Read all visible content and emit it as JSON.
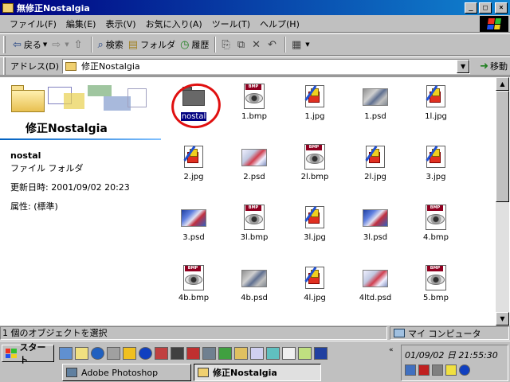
{
  "window": {
    "title": "無修正Nostalgia",
    "minimize": "_",
    "maximize": "□",
    "close": "×"
  },
  "menu": [
    "ファイル(F)",
    "編集(E)",
    "表示(V)",
    "お気に入り(A)",
    "ツール(T)",
    "ヘルプ(H)"
  ],
  "toolbar": {
    "back": "戻る",
    "search": "検索",
    "folders": "フォルダ",
    "history": "履歴"
  },
  "address": {
    "label": "アドレス(D)",
    "value": "修正Nostalgia",
    "go": "移動"
  },
  "leftpane": {
    "title": "修正Nostalgia",
    "selected_name": "nostal",
    "selected_type": "ファイル フォルダ",
    "selected_date": "更新日時: 2001/09/02 20:23",
    "selected_attr": "属性: (標準)"
  },
  "files": [
    {
      "name": "nostal",
      "type": "folder",
      "selected": true
    },
    {
      "name": "1.bmp",
      "type": "bmp"
    },
    {
      "name": "1.jpg",
      "type": "jpg"
    },
    {
      "name": "1.psd",
      "type": "psd",
      "variant": "grey"
    },
    {
      "name": "1l.jpg",
      "type": "jpg"
    },
    {
      "name": "2.jpg",
      "type": "jpg"
    },
    {
      "name": "2.psd",
      "type": "psd",
      "variant": "light"
    },
    {
      "name": "2l.bmp",
      "type": "bmp"
    },
    {
      "name": "2l.jpg",
      "type": "jpg"
    },
    {
      "name": "3.jpg",
      "type": "jpg"
    },
    {
      "name": "3.psd",
      "type": "psd",
      "variant": "blue"
    },
    {
      "name": "3l.bmp",
      "type": "bmp"
    },
    {
      "name": "3l.jpg",
      "type": "jpg"
    },
    {
      "name": "3l.psd",
      "type": "psd",
      "variant": "blue"
    },
    {
      "name": "4.bmp",
      "type": "bmp"
    },
    {
      "name": "4b.bmp",
      "type": "bmp"
    },
    {
      "name": "4b.psd",
      "type": "psd",
      "variant": "grey"
    },
    {
      "name": "4l.jpg",
      "type": "jpg"
    },
    {
      "name": "4ltd.psd",
      "type": "psd",
      "variant": "light"
    },
    {
      "name": "5.bmp",
      "type": "bmp"
    }
  ],
  "statusbar": {
    "left": "1 個のオブジェクトを選択",
    "right": "マイ コンピュータ"
  },
  "taskbar": {
    "start": "スタート",
    "tasks": [
      "Adobe Photoshop",
      "修正Nostalgia"
    ],
    "clock": "01/09/02 日 21:55:30"
  },
  "colors": {
    "title_bar": "#000080",
    "selection": "#000080",
    "annotation_circle": "#e01010"
  }
}
